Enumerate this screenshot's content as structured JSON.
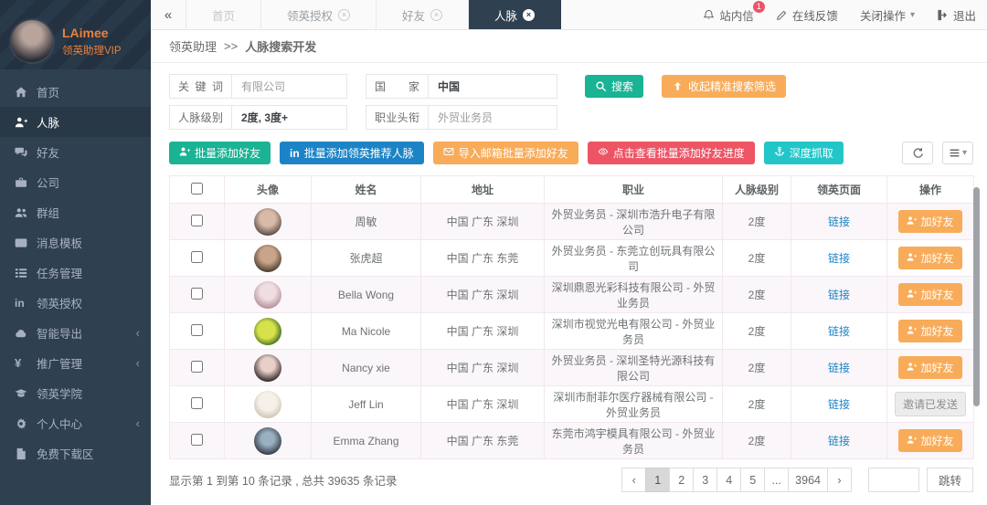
{
  "user": {
    "name": "LAimee",
    "role": "领英助理VIP"
  },
  "colors": {
    "navy": "#2f4050",
    "green": "#1ab394",
    "blue": "#1c84c6",
    "orange": "#f8ac59",
    "red": "#ed5565",
    "teal": "#23c6c8",
    "link": "#1c84c6",
    "accent_orange": "#e8813c",
    "badge": "#ed5565"
  },
  "topbar": {
    "tabs": [
      {
        "key": "home",
        "label": "首页",
        "closable": false,
        "active": false,
        "muted": true
      },
      {
        "key": "linkedin-auth",
        "label": "领英授权",
        "closable": true,
        "active": false,
        "muted": false
      },
      {
        "key": "friends",
        "label": "好友",
        "closable": true,
        "active": false,
        "muted": false
      },
      {
        "key": "connections",
        "label": "人脉",
        "closable": true,
        "active": true,
        "muted": false
      }
    ],
    "right": {
      "messages_label": "站内信",
      "messages_badge": "1",
      "feedback_label": "在线反馈",
      "close_ops_label": "关闭操作",
      "logout_label": "退出"
    }
  },
  "sidebar": {
    "items": [
      {
        "key": "home",
        "icon": "home-icon",
        "label": "首页",
        "active": false,
        "chevron": false
      },
      {
        "key": "connections",
        "icon": "user-plus-icon",
        "label": "人脉",
        "active": true,
        "chevron": false
      },
      {
        "key": "friends",
        "icon": "comments-icon",
        "label": "好友",
        "active": false,
        "chevron": false
      },
      {
        "key": "company",
        "icon": "briefcase-icon",
        "label": "公司",
        "active": false,
        "chevron": false
      },
      {
        "key": "groups",
        "icon": "users-icon",
        "label": "群组",
        "active": false,
        "chevron": false
      },
      {
        "key": "message-templates",
        "icon": "envelope-icon",
        "label": "消息模板",
        "active": false,
        "chevron": false
      },
      {
        "key": "task-management",
        "icon": "tasks-icon",
        "label": "任务管理",
        "active": false,
        "chevron": false
      },
      {
        "key": "linkedin-auth",
        "icon": "linkedin-icon",
        "label": "领英授权",
        "active": false,
        "chevron": false
      },
      {
        "key": "smart-export",
        "icon": "cloud-icon",
        "label": "智能导出",
        "active": false,
        "chevron": true
      },
      {
        "key": "promotion",
        "icon": "yen-icon",
        "label": "推广管理",
        "active": false,
        "chevron": true
      },
      {
        "key": "academy",
        "icon": "graduation-icon",
        "label": "领英学院",
        "active": false,
        "chevron": false
      },
      {
        "key": "personal-center",
        "icon": "gear-icon",
        "label": "个人中心",
        "active": false,
        "chevron": true
      },
      {
        "key": "free-downloads",
        "icon": "file-icon",
        "label": "免费下载区",
        "active": false,
        "chevron": false
      }
    ]
  },
  "breadcrumb": {
    "parent": "领英助理",
    "separator": ">>",
    "current": "人脉搜索开发"
  },
  "filters": {
    "keyword": {
      "label": "关键词",
      "value": "有限公司"
    },
    "country": {
      "label": "国家",
      "value": "中国"
    },
    "degree": {
      "label": "人脉级别",
      "value": "2度, 3度+"
    },
    "title": {
      "label": "职业头衔",
      "value": "外贸业务员"
    },
    "search_label": "搜索",
    "collapse_label": "收起精准搜索筛选"
  },
  "toolbar": {
    "buttons": [
      {
        "key": "batch-add-friends",
        "label": "批量添加好友",
        "icon": "user-plus-icon",
        "color": "#1ab394"
      },
      {
        "key": "batch-add-linkedin-recommended",
        "label": "批量添加领英推荐人脉",
        "icon": "linkedin-icon",
        "color": "#1c84c6"
      },
      {
        "key": "import-email-batch-add",
        "label": "导入邮箱批量添加好友",
        "icon": "envelope-icon",
        "color": "#f8ac59"
      },
      {
        "key": "view-batch-progress",
        "label": "点击查看批量添加好友进度",
        "icon": "eye-icon",
        "color": "#ed5565"
      },
      {
        "key": "deep-scrape",
        "label": "深度抓取",
        "icon": "anchor-icon",
        "color": "#23c6c8"
      }
    ]
  },
  "table": {
    "columns": [
      "头像",
      "姓名",
      "地址",
      "职业",
      "人脉级别",
      "领英页面",
      "操作"
    ],
    "link_label": "链接",
    "add_friend_label": "加好友",
    "invited_label": "邀请已发送",
    "rows": [
      {
        "name": "周敏",
        "address": "中国 广东 深圳",
        "job": "外贸业务员 - 深圳市浩升电子有限公司",
        "degree": "2度",
        "action": "add"
      },
      {
        "name": "张虎超",
        "address": "中国 广东 东莞",
        "job": "外贸业务员 - 东莞立创玩具有限公司",
        "degree": "2度",
        "action": "add"
      },
      {
        "name": "Bella Wong",
        "address": "中国 广东 深圳",
        "job": "深圳鼎恩光彩科技有限公司 - 外贸业务员",
        "degree": "2度",
        "action": "add"
      },
      {
        "name": "Ma Nicole",
        "address": "中国 广东 深圳",
        "job": "深圳市视觉光电有限公司 - 外贸业务员",
        "degree": "2度",
        "action": "add"
      },
      {
        "name": "Nancy xie",
        "address": "中国 广东 深圳",
        "job": "外贸业务员 - 深圳圣特光源科技有限公司",
        "degree": "2度",
        "action": "add"
      },
      {
        "name": "Jeff Lin",
        "address": "中国 广东 深圳",
        "job": "深圳市耐菲尔医疗器械有限公司 - 外贸业务员",
        "degree": "2度",
        "action": "invited"
      },
      {
        "name": "Emma Zhang",
        "address": "中国 广东 东莞",
        "job": "东莞市鸿宇模具有限公司 - 外贸业务员",
        "degree": "2度",
        "action": "add"
      }
    ]
  },
  "footer": {
    "summary": "显示第 1 到第 10 条记录 , 总共 39635 条记录",
    "pagination": {
      "prev": "‹",
      "pages": [
        "1",
        "2",
        "3",
        "4",
        "5",
        "...",
        "3964"
      ],
      "active": "1",
      "next": "›",
      "jump_label": "跳转"
    }
  }
}
